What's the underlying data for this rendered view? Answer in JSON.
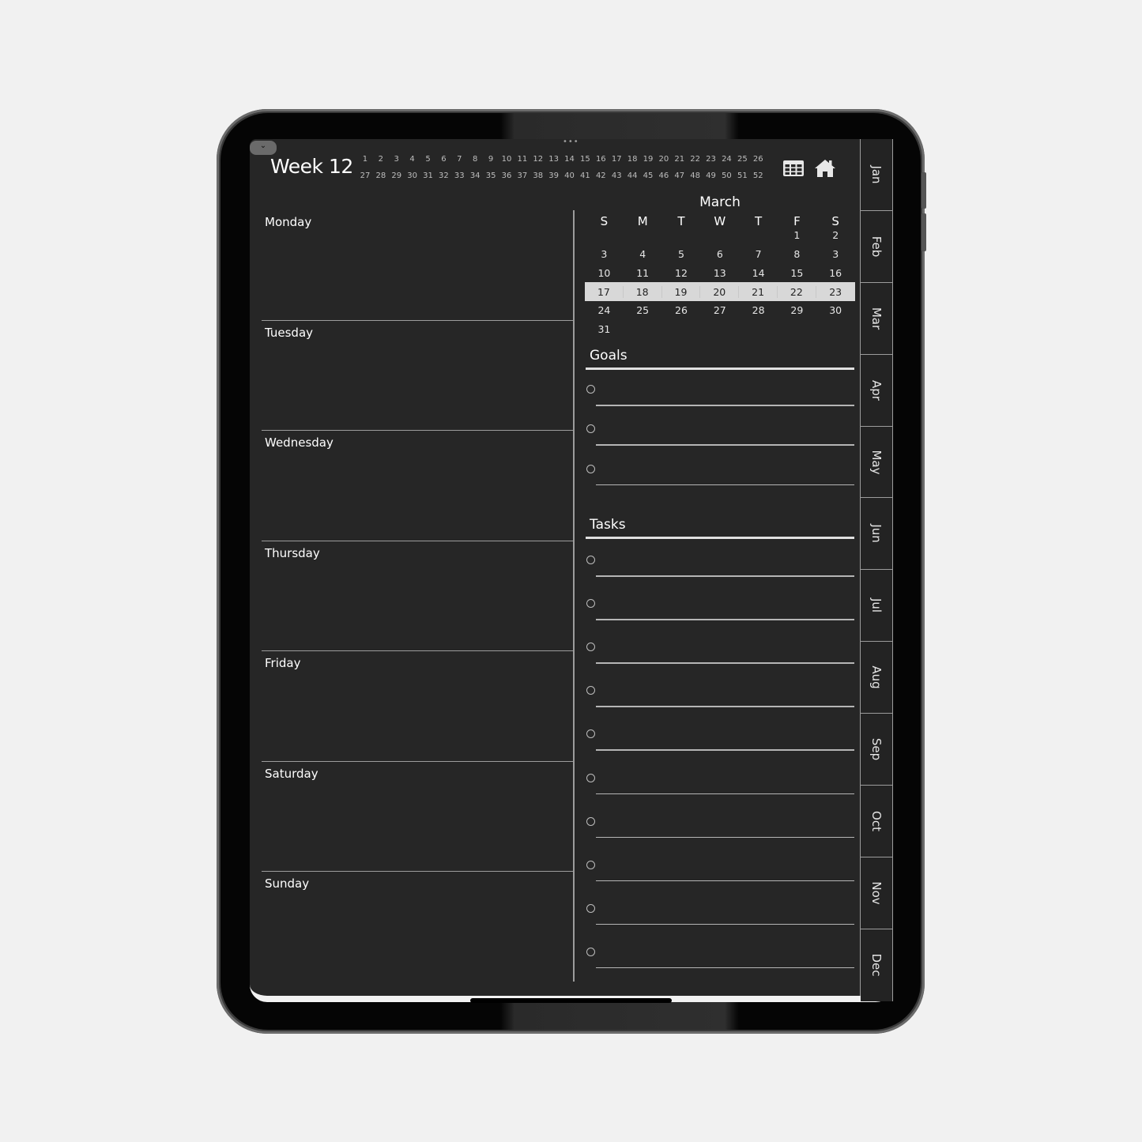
{
  "header": {
    "week_title": "Week 12",
    "collapse_glyph": "⌄",
    "drag_handle_glyph": "•••",
    "week_numbers_row1": [
      "1",
      "2",
      "3",
      "4",
      "5",
      "6",
      "7",
      "8",
      "9",
      "10",
      "11",
      "12",
      "13",
      "14",
      "15",
      "16",
      "17",
      "18",
      "19",
      "20",
      "21",
      "22",
      "23",
      "24",
      "25",
      "26"
    ],
    "week_numbers_row2": [
      "27",
      "28",
      "29",
      "30",
      "31",
      "32",
      "33",
      "34",
      "35",
      "36",
      "37",
      "38",
      "39",
      "40",
      "41",
      "42",
      "43",
      "44",
      "45",
      "46",
      "47",
      "48",
      "49",
      "50",
      "51",
      "52"
    ],
    "icons": [
      "grid-icon",
      "home-icon"
    ]
  },
  "days": [
    "Monday",
    "Tuesday",
    "Wednesday",
    "Thursday",
    "Friday",
    "Saturday",
    "Sunday"
  ],
  "mini_calendar": {
    "month": "March",
    "weekday_headers": [
      "S",
      "M",
      "T",
      "W",
      "T",
      "F",
      "S"
    ],
    "weeks": [
      [
        "",
        "",
        "",
        "",
        "",
        "1",
        "2"
      ],
      [
        "3",
        "4",
        "5",
        "6",
        "7",
        "8",
        "3"
      ],
      [
        "10",
        "11",
        "12",
        "13",
        "14",
        "15",
        "16"
      ],
      [
        "17",
        "18",
        "19",
        "20",
        "21",
        "22",
        "23"
      ],
      [
        "24",
        "25",
        "26",
        "27",
        "28",
        "29",
        "30"
      ],
      [
        "31",
        "",
        "",
        "",
        "",
        "",
        ""
      ]
    ],
    "highlighted_week_index": 3
  },
  "goals": {
    "title": "Goals",
    "item_count": 3
  },
  "tasks": {
    "title": "Tasks",
    "item_count": 10
  },
  "month_tabs": [
    "Jan",
    "Feb",
    "Mar",
    "Apr",
    "May",
    "Jun",
    "Jul",
    "Aug",
    "Sep",
    "Oct",
    "Nov",
    "Dec"
  ],
  "colors": {
    "screen_bg": "#262626",
    "text": "#ffffff",
    "rule": "#9c9c9c",
    "highlight_row": "#d8d8d8"
  }
}
